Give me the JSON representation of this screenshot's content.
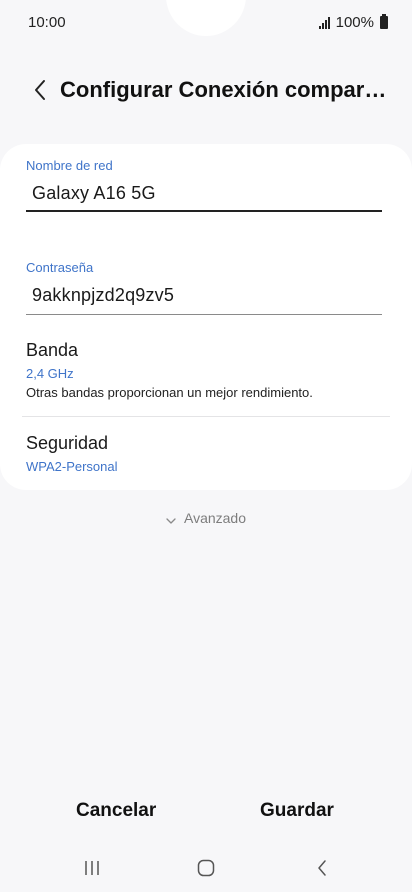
{
  "status_bar": {
    "time": "10:00",
    "battery": "100%"
  },
  "header": {
    "title": "Configurar Conexión compart..."
  },
  "form": {
    "network_name": {
      "label": "Nombre de red",
      "value": "Galaxy A16 5G"
    },
    "password": {
      "label": "Contraseña",
      "value": "9akknpjzd2q9zv5"
    },
    "band": {
      "title": "Banda",
      "value": "2,4 GHz",
      "description": "Otras bandas proporcionan un mejor rendimiento."
    },
    "security": {
      "title": "Seguridad",
      "value": "WPA2-Personal"
    }
  },
  "advanced": {
    "label": "Avanzado"
  },
  "actions": {
    "cancel_label": "Cancelar",
    "save_label": "Guardar"
  },
  "icons": {
    "back": "chevron-left-icon",
    "advanced": "chevron-down-icon",
    "nav_recents": "recents-icon",
    "nav_home": "home-icon",
    "nav_back": "back-icon"
  },
  "colors": {
    "accent": "#3f74c9",
    "background": "#f7f7f9",
    "card": "#ffffff"
  }
}
